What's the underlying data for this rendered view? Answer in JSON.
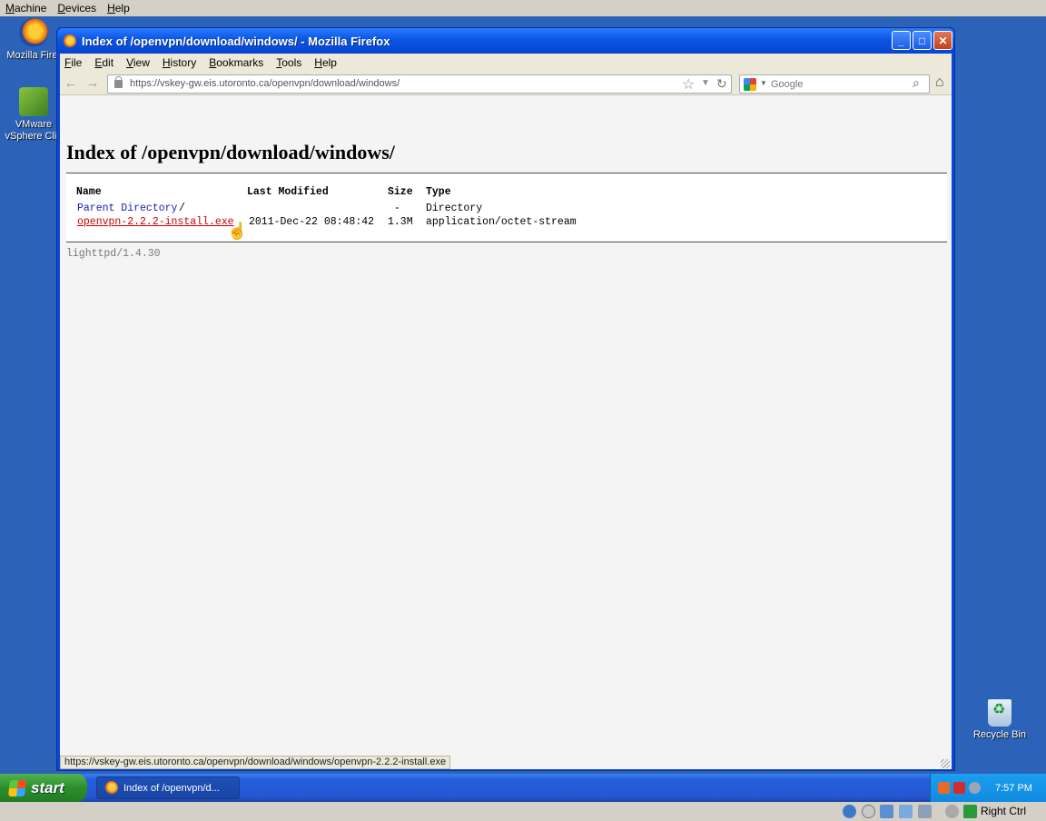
{
  "vbox": {
    "menu": [
      "Machine",
      "Devices",
      "Help"
    ],
    "host_key": "Right Ctrl"
  },
  "desktop": {
    "icons": [
      {
        "label": "Mozilla Firef",
        "icon": "firefox-icon"
      },
      {
        "label": "VMware vSphere Clie",
        "icon": "vmware-icon"
      },
      {
        "label": "Recycle Bin",
        "icon": "recycle-bin-icon"
      }
    ]
  },
  "window": {
    "title": "Index of /openvpn/download/windows/ - Mozilla Firefox",
    "controls": {
      "minimize": "_",
      "maximize": "□",
      "close": "✕"
    }
  },
  "firefox": {
    "menu": [
      "File",
      "Edit",
      "View",
      "History",
      "Bookmarks",
      "Tools",
      "Help"
    ],
    "url": "https://vskey-gw.eis.utoronto.ca/openvpn/download/windows/",
    "search_placeholder": "Google"
  },
  "page": {
    "title": "Index of /openvpn/download/windows/",
    "columns": {
      "name": "Name",
      "modified": "Last Modified",
      "size": "Size",
      "type": "Type"
    },
    "rows": [
      {
        "name": "Parent Directory",
        "suffix": "/",
        "modified": "",
        "size": "-",
        "type": "Directory"
      },
      {
        "name": "openvpn-2.2.2-install.exe",
        "suffix": "",
        "modified": "2011-Dec-22 08:48:42",
        "size": "1.3M",
        "type": "application/octet-stream"
      }
    ],
    "server": "lighttpd/1.4.30"
  },
  "status": {
    "text": "https://vskey-gw.eis.utoronto.ca/openvpn/download/windows/openvpn-2.2.2-install.exe"
  },
  "taskbar": {
    "start_label": "start",
    "task_label": "Index of /openvpn/d...",
    "clock": "7:57 PM"
  },
  "colors": {
    "desktop": "#2c63b8",
    "titlebar": "#0a55e3",
    "link": "#1a1ab8",
    "active_link": "#cc0000"
  }
}
